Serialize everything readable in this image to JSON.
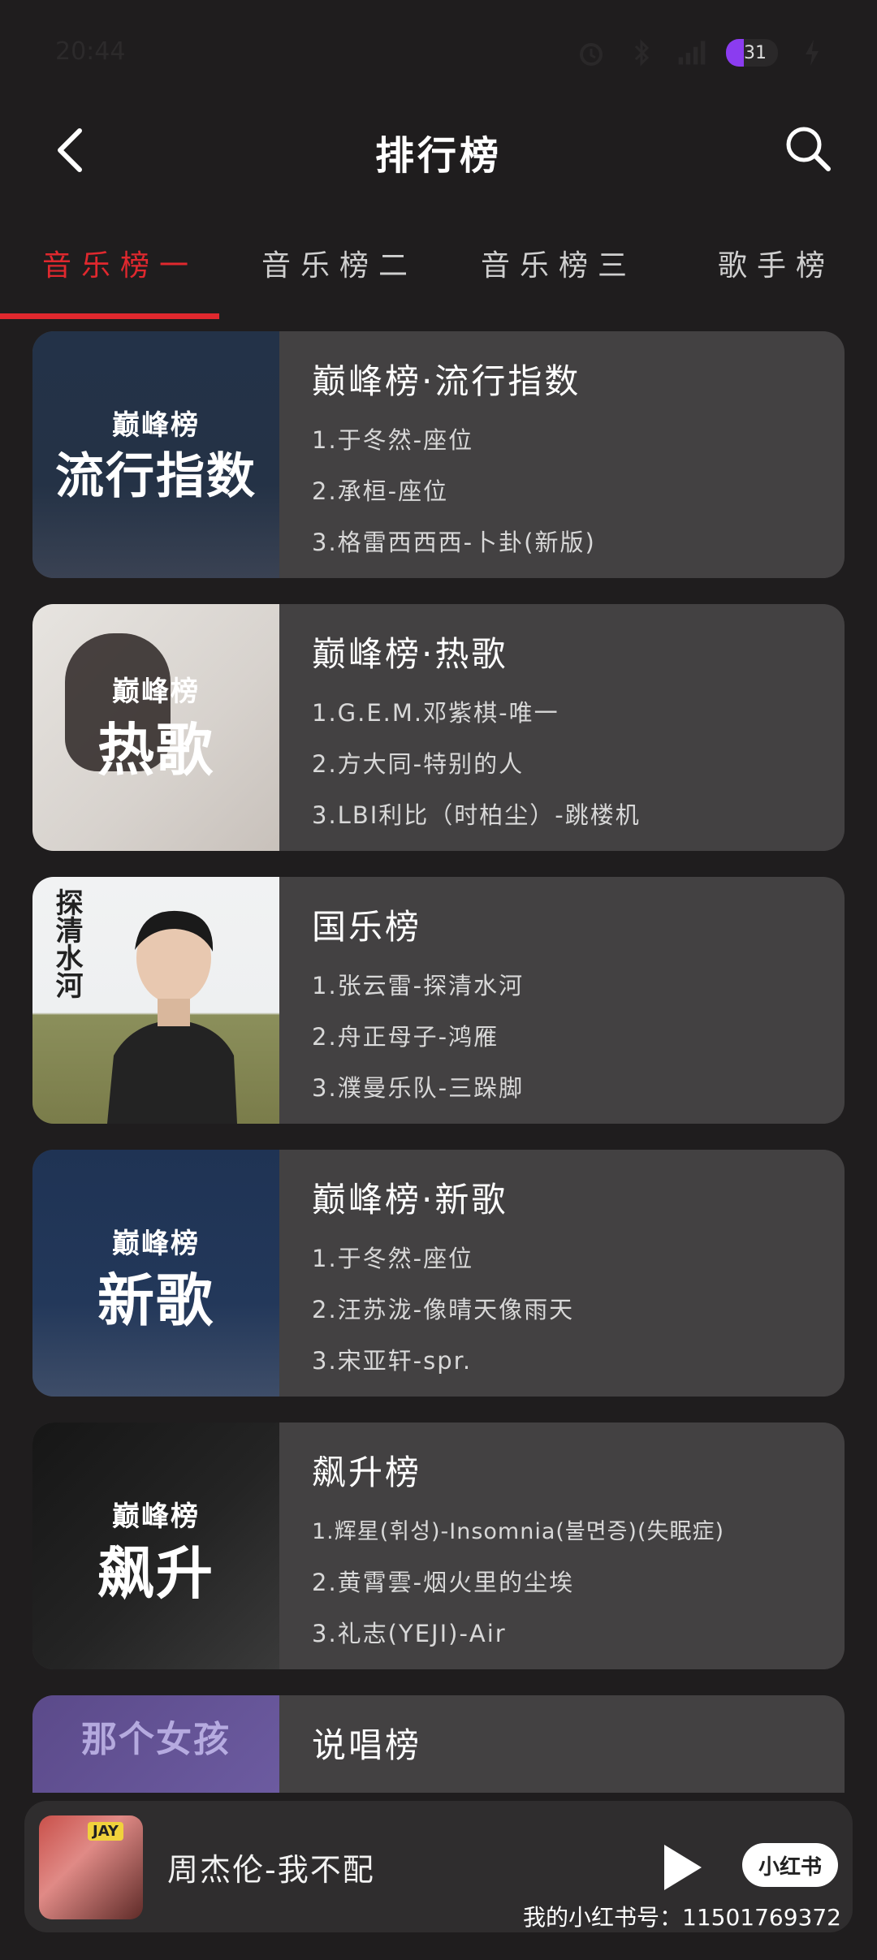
{
  "status": {
    "time": "20:44",
    "battery": "31"
  },
  "header": {
    "title": "排行榜"
  },
  "tabs": [
    {
      "label": "音乐榜一"
    },
    {
      "label": "音乐榜二"
    },
    {
      "label": "音乐榜三"
    },
    {
      "label": "歌手榜"
    }
  ],
  "cards": [
    {
      "cover_brand": "巅峰榜",
      "cover_label": "流行指数",
      "title": "巅峰榜·流行指数",
      "songs": [
        "1.于冬然-座位",
        "2.承桓-座位",
        "3.格雷西西西-卜卦(新版)"
      ]
    },
    {
      "cover_brand": "巅峰榜",
      "cover_label": "热歌",
      "title": "巅峰榜·热歌",
      "songs": [
        "1.G.E.M.邓紫棋-唯一",
        "2.方大同-特别的人",
        "3.LBI利比（时柏尘）-跳楼机"
      ]
    },
    {
      "cover_side": "探清水河",
      "title": "国乐榜",
      "songs": [
        "1.张云雷-探清水河",
        "2.舟正母子-鸿雁",
        "3.濮曼乐队-三跺脚"
      ]
    },
    {
      "cover_brand": "巅峰榜",
      "cover_label": "新歌",
      "title": "巅峰榜·新歌",
      "songs": [
        "1.于冬然-座位",
        "2.汪苏泷-像晴天像雨天",
        "3.宋亚轩-spr."
      ]
    },
    {
      "cover_brand": "巅峰榜",
      "cover_label": "飙升",
      "title": "飙升榜",
      "songs": [
        "1.辉星(휘성)-Insomnia(불면증)(失眠症)",
        "2.黄霄雲-烟火里的尘埃",
        "3.礼志(YEJI)-Air"
      ]
    },
    {
      "cover_side": "那个女孩",
      "title": "说唱榜",
      "songs": []
    }
  ],
  "player": {
    "song": "周杰伦-我不配",
    "cover_badge": "JAY",
    "xhs_label": "小红书"
  },
  "watermark": "我的小红书号：11501769372",
  "colors": {
    "accent": "#e0282e",
    "background": "#1f1d1e",
    "card": "#434142"
  }
}
